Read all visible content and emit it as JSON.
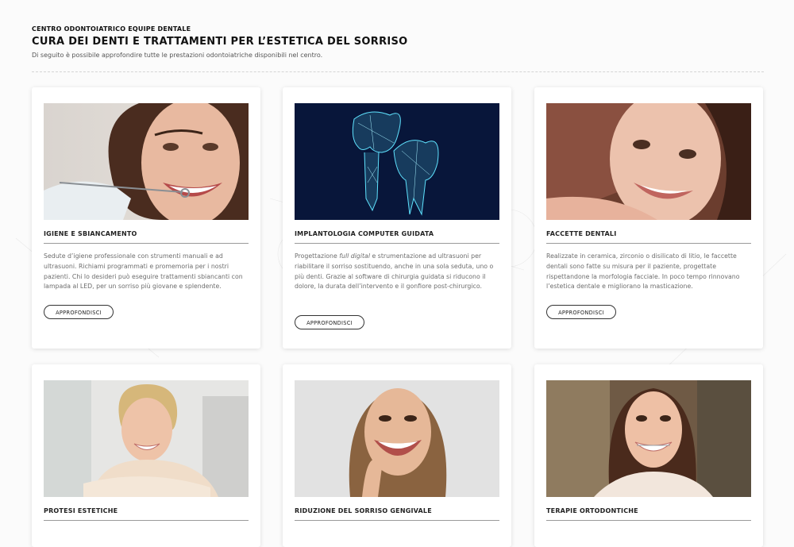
{
  "header": {
    "eyebrow": "CENTRO ODONTOIATRICO EQUIPE DENTALE",
    "title": "CURA DEI DENTI E TRATTAMENTI PER L’ESTETICA DEL SORRISO",
    "subtitle": "Di seguito è possibile approfondire tutte le prestazioni odontoiatriche disponibili nel centro."
  },
  "cards": [
    {
      "title": "IGIENE E SBIANCAMENTO",
      "text": "Sedute d’igiene professionale con strumenti manuali e ad ultrasuoni. Richiami programmati e promemoria per i nostri pazienti. Chi lo desideri può eseguire trattamenti sbiancanti con lampada al LED, per un sorriso più giovane e splendente.",
      "button": "APPROFONDISCI",
      "image": "smiling woman at dental check-up"
    },
    {
      "title": "IMPLANTOLOGIA COMPUTER GUIDATA",
      "text_before": "Progettazione ",
      "text_em": "full digital",
      "text_after": " e strumentazione ad ultrasuoni per riabilitare il sorriso sostituendo, anche in una sola seduta, uno o più denti. Grazie al software di chirurgia guidata si riducono il dolore, la durata dell’intervento e il gonfiore post-chirurgico.",
      "button": "APPROFONDISCI",
      "image": "digital 3D dental implant illustration"
    },
    {
      "title": "FACCETTE DENTALI",
      "text": "Realizzate in ceramica, zirconio o disilicato di litio, le faccette dentali sono fatte su misura per il paziente, progettate rispettandone la morfologia facciale. In poco tempo rinnovano l’estetica dentale e migliorano la masticazione.",
      "button": "APPROFONDISCI",
      "image": "smiling young woman close-up"
    },
    {
      "title": "PROTESI ESTETICHE",
      "image": "smiling blonde mature woman"
    },
    {
      "title": "RIDUZIONE DEL SORRISO GENGIVALE",
      "image": "laughing woman pointing to her smile"
    },
    {
      "title": "TERAPIE ORTODONTICHE",
      "image": "smiling young woman with braces"
    }
  ],
  "colors": {
    "page_bg": "#fbfbfb",
    "card_bg": "#ffffff",
    "implant_bg": "#08163a",
    "implant_glow": "#5fe3ff"
  }
}
